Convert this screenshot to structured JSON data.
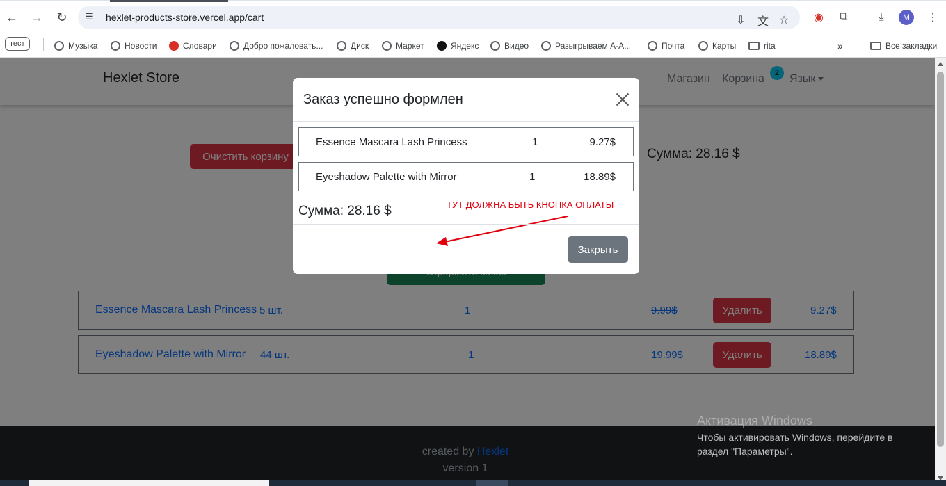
{
  "browser": {
    "url": "hexlet-products-store.vercel.app/cart",
    "avatar_letter": "M",
    "bookmarks": [
      {
        "label": "тест"
      },
      {
        "label": "Музыка"
      },
      {
        "label": "Новости"
      },
      {
        "label": "Словари"
      },
      {
        "label": "Добро пожаловать..."
      },
      {
        "label": "Диск"
      },
      {
        "label": "Маркет"
      },
      {
        "label": "Яндекс"
      },
      {
        "label": "Видео"
      },
      {
        "label": "Разыгрываем А-А..."
      },
      {
        "label": "Почта"
      },
      {
        "label": "Карты"
      },
      {
        "label": "rita"
      }
    ],
    "more_bookmarks": "»",
    "all_bookmarks": "Все закладки"
  },
  "navbar": {
    "brand": "Hexlet Store",
    "shop": "Магазин",
    "cart": "Корзина",
    "cart_count": "2",
    "language": "Язык"
  },
  "cart": {
    "clear_button": "Очистить корзину",
    "total": "Сумма: 28.16 $",
    "order_button": "Оформить заказ",
    "delete_label": "Удалить",
    "items": [
      {
        "name": "Essence Mascara Lash Princess",
        "stock": "5 шт.",
        "qty": "1",
        "old_price": "9.99$",
        "price": "9.27$"
      },
      {
        "name": "Eyeshadow Palette with Mirror",
        "stock": "44 шт.",
        "qty": "1",
        "old_price": "19.99$",
        "price": "18.89$"
      }
    ]
  },
  "modal": {
    "title": "Заказ успешно формлен",
    "items": [
      {
        "name": "Essence Mascara Lash Princess",
        "qty": "1",
        "price": "9.27$"
      },
      {
        "name": "Eyeshadow Palette with Mirror",
        "qty": "1",
        "price": "18.89$"
      }
    ],
    "total": "Сумма: 28.16 $",
    "close_button": "Закрыть",
    "annotation": "ТУТ ДОЛЖНА БЫТЬ КНОПКА ОПЛАТЫ",
    "annotation_color": "#e0000e"
  },
  "footer": {
    "created_prefix": "created by",
    "created_link": "Hexlet",
    "version": "version 1"
  },
  "watermark": {
    "title": "Активация Windows",
    "text": "Чтобы активировать Windows, перейдите в раздел \"Параметры\"."
  }
}
